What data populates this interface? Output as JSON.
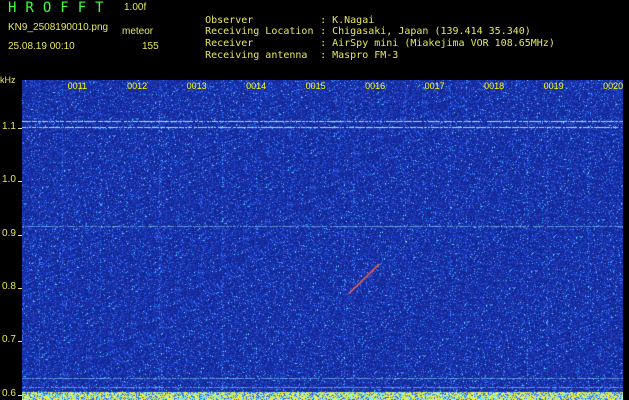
{
  "header": {
    "app_title": "HROFFT",
    "version": "1.00f",
    "filename": "KN9_2508190010.png",
    "mode": "meteor",
    "datetime": "25.08.19 00:10",
    "count": "155"
  },
  "info": [
    {
      "key": "Observer",
      "sep": ":",
      "value": "K.Nagai"
    },
    {
      "key": "Receiving Location",
      "sep": ":",
      "value": "Chigasaki, Japan (139.414 35.340)"
    },
    {
      "key": "Receiver",
      "sep": ":",
      "value": "AirSpy mini (Miakejima VOR 108.65MHz)"
    },
    {
      "key": "Receiving antenna",
      "sep": ":",
      "value": "Maspro FM-3"
    }
  ],
  "chart_data": {
    "type": "heatmap",
    "ylabel": "kHz",
    "ylim": [
      0.59,
      1.19
    ],
    "yticks": [
      "1.1",
      "1.0",
      "0.9",
      "0.8",
      "0.7",
      "0.6"
    ],
    "ytick_values": [
      1.1,
      1.0,
      0.9,
      0.8,
      0.7,
      0.6
    ],
    "xticks": [
      "0011",
      "0012",
      "0013",
      "0014",
      "0015",
      "0016",
      "0017",
      "0018",
      "0019",
      "0020"
    ],
    "xlim_minutes": [
      10.2,
      20.3
    ],
    "carrier_lines_khz": [
      1.113,
      1.102,
      0.917,
      0.615,
      0.632
    ],
    "meteor_echo": {
      "time_minutes": 15.7,
      "freq_khz_start": 0.845,
      "freq_khz_end": 0.79
    },
    "colors": {
      "background": "#1a3ab8",
      "noise": "#2d6bff",
      "line": "#9ef0ff",
      "echo": "#ff6040"
    }
  }
}
